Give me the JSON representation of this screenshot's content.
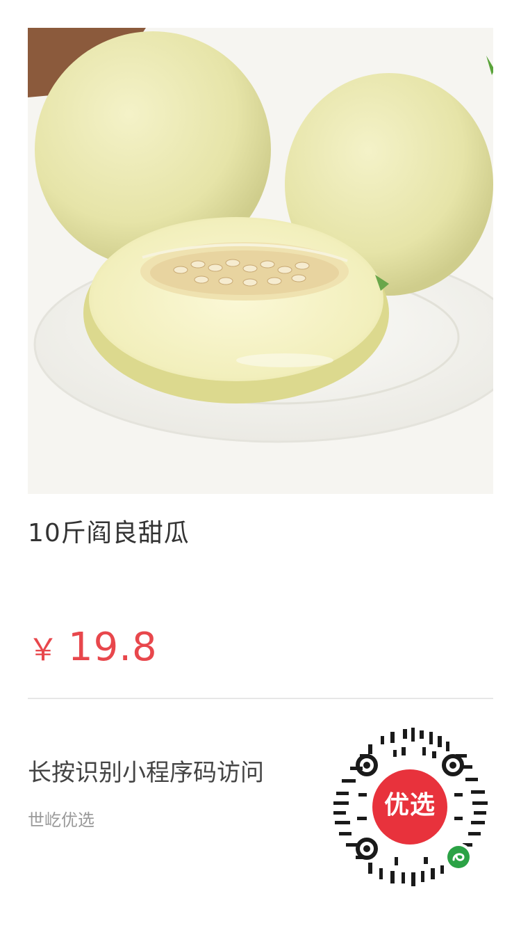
{
  "product": {
    "title": "10斤阎良甜瓜",
    "image_alt": "melon-photo"
  },
  "price": {
    "currency": "￥",
    "value": "19.8"
  },
  "share": {
    "hint": "长按识别小程序码访问",
    "shop_name": "世屹优选",
    "qr_logo_text": "优选"
  },
  "colors": {
    "price": "#e8474c",
    "qr_logo_bg": "#e8323c",
    "mini_program_badge": "#2ba245"
  }
}
